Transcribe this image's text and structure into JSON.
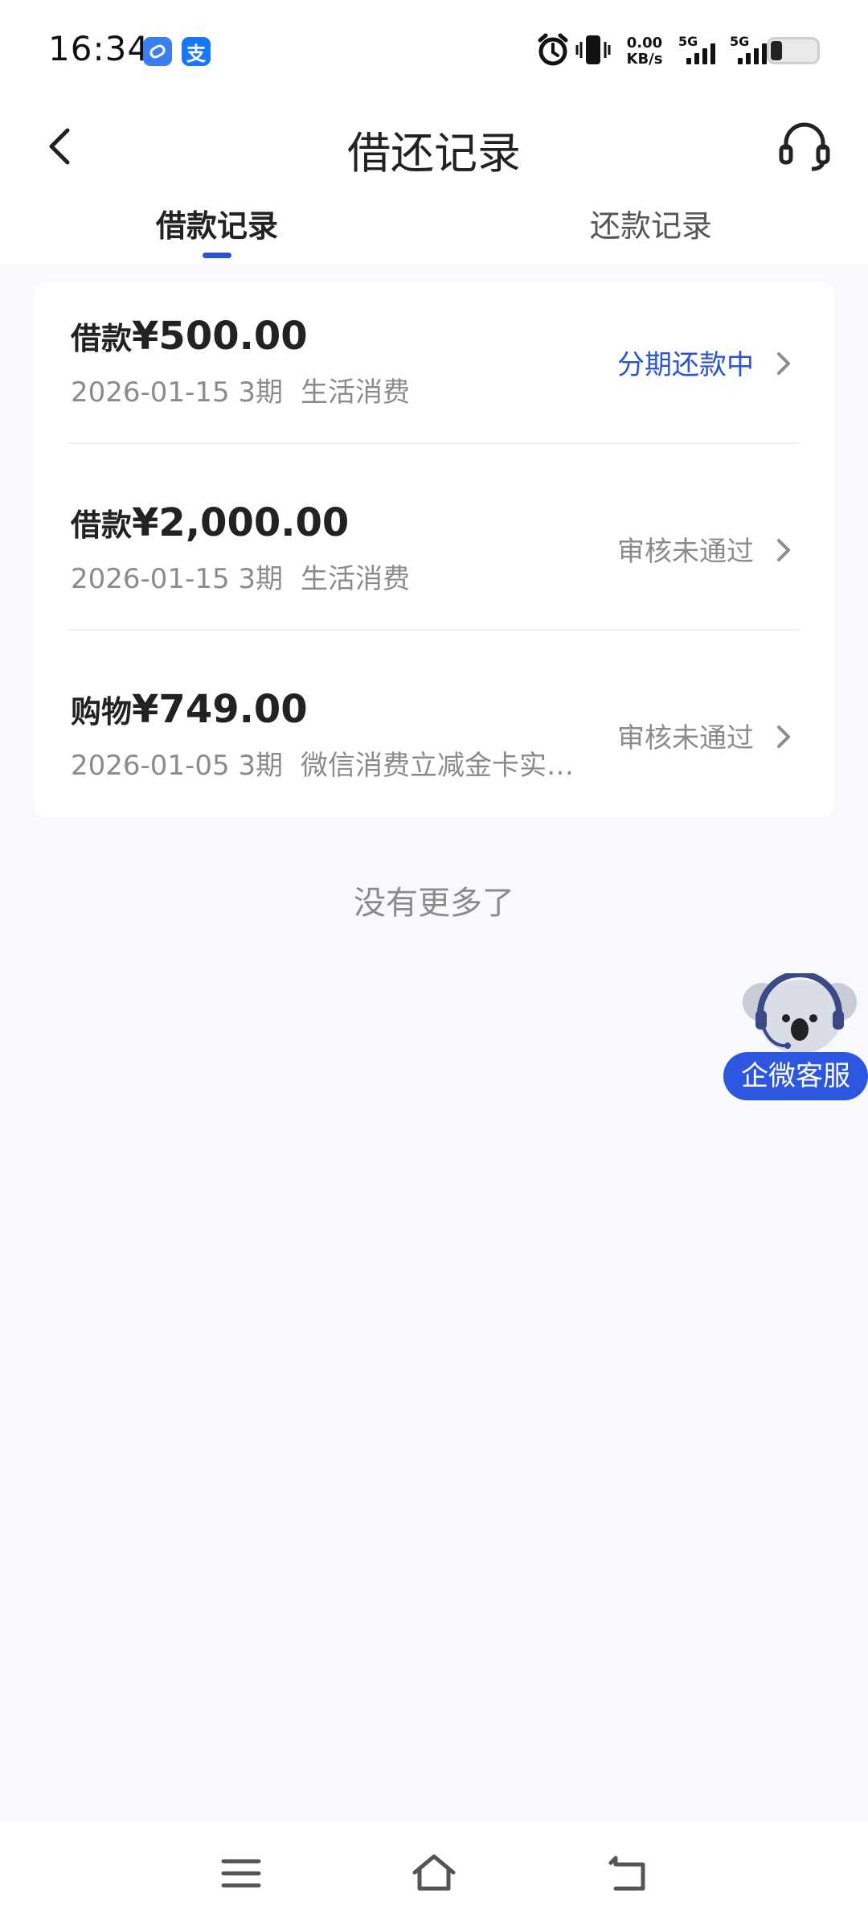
{
  "status_bar": {
    "time": "16:34",
    "app_badge_1": "app-bubble-icon",
    "app_badge_2": "支",
    "net_speed_value": "0.00",
    "net_speed_unit": "KB/s",
    "sim1_label": "5G",
    "sim2_label": "5G"
  },
  "header": {
    "title": "借还记录",
    "back_icon": "chevron-left-icon",
    "support_icon": "headset-icon"
  },
  "tabs": [
    {
      "label": "借款记录",
      "active": true
    },
    {
      "label": "还款记录",
      "active": false
    }
  ],
  "records": [
    {
      "type_label": "借款",
      "amount": "¥500.00",
      "date": "2026-01-15",
      "periods": "3期",
      "purpose": "生活消费",
      "status": "分期还款中",
      "status_active": true
    },
    {
      "type_label": "借款",
      "amount": "¥2,000.00",
      "date": "2026-01-15",
      "periods": "3期",
      "purpose": "生活消费",
      "status": "审核未通过",
      "status_active": false
    },
    {
      "type_label": "购物",
      "amount": "¥749.00",
      "date": "2026-01-05",
      "periods": "3期",
      "purpose": "微信消费立减金卡实…",
      "status": "审核未通过",
      "status_active": false
    }
  ],
  "footer_text": "没有更多了",
  "float_service": {
    "label": "企微客服",
    "icon": "koala-mascot-icon"
  },
  "colors": {
    "accent": "#2b53d6",
    "background": "#f8f9fd",
    "muted_text": "#8b8b8b",
    "pill": "#2d57e0"
  }
}
